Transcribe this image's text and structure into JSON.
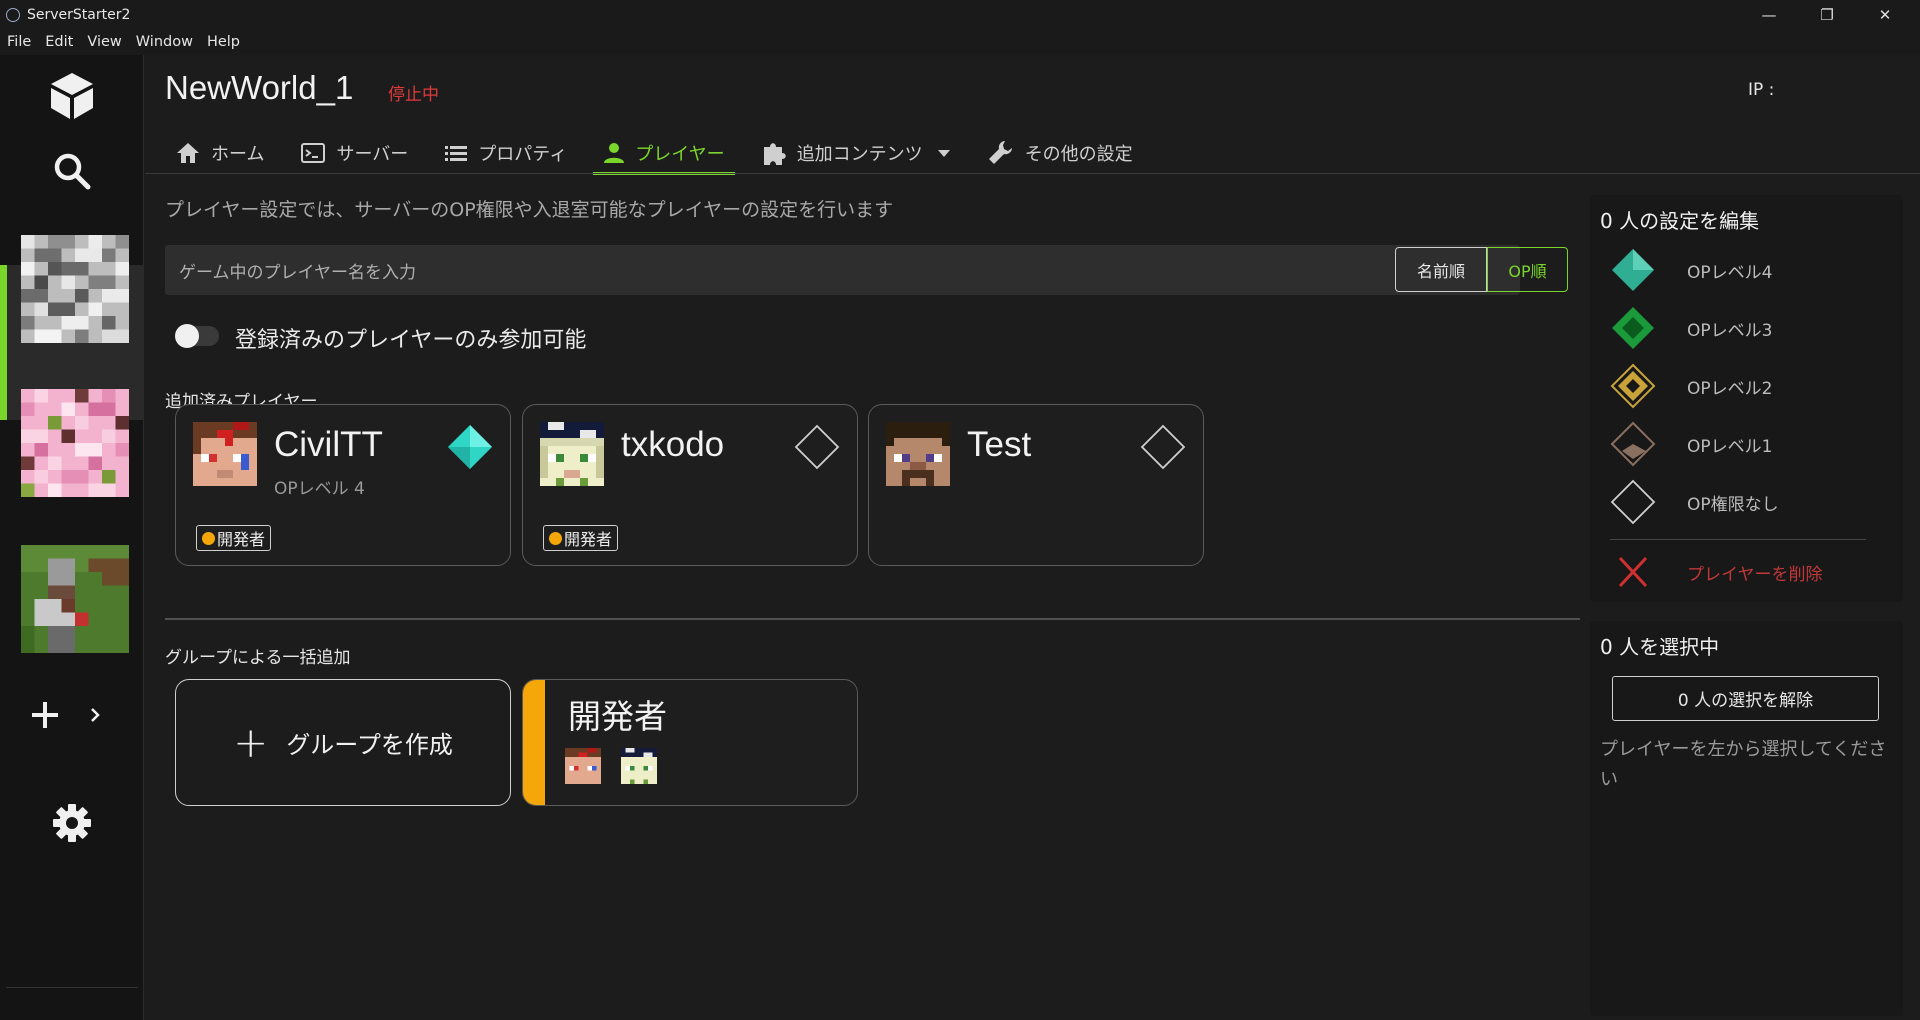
{
  "window": {
    "title": "ServerStarter2"
  },
  "menu": [
    "File",
    "Edit",
    "View",
    "Window",
    "Help"
  ],
  "server": {
    "name": "NewWorld_1",
    "status": "停止中",
    "ip_label": "IP :"
  },
  "tabs": [
    {
      "label": "ホーム",
      "icon": "home-icon"
    },
    {
      "label": "サーバー",
      "icon": "terminal-icon"
    },
    {
      "label": "プロパティ",
      "icon": "list-icon"
    },
    {
      "label": "プレイヤー",
      "icon": "person-icon",
      "active": true
    },
    {
      "label": "追加コンテンツ",
      "icon": "puzzle-icon"
    },
    {
      "label": "その他の設定",
      "icon": "wrench-icon"
    }
  ],
  "players_page": {
    "description": "プレイヤー設定では、サーバーのOP権限や入退室可能なプレイヤーの設定を行います",
    "search_placeholder": "ゲーム中のプレイヤー名を入力",
    "sort_name": "名前順",
    "sort_op": "OP順",
    "whitelist_label": "登録済みのプレイヤーのみ参加可能",
    "added_title": "追加済みプレイヤー",
    "group_title": "グループによる一括追加",
    "create_group": "グループを作成"
  },
  "players": [
    {
      "name": "CivilTT",
      "level": "OPレベル 4",
      "group": "開発者",
      "op_color": "#3fe0d0"
    },
    {
      "name": "txkodo",
      "level": "",
      "group": "開発者",
      "op_color": ""
    },
    {
      "name": "Test",
      "level": "",
      "group": "",
      "op_color": ""
    }
  ],
  "groups": [
    {
      "name": "開発者",
      "color": "#f5a70a"
    }
  ],
  "edit_panel": {
    "title": "0 人の設定を編集",
    "levels": [
      {
        "label": "OPレベル4",
        "color": "#2fae94"
      },
      {
        "label": "OPレベル3",
        "color": "#1a9a3a"
      },
      {
        "label": "OPレベル2",
        "color": "#c9a23a"
      },
      {
        "label": "OPレベル1",
        "color": "#8a7060"
      },
      {
        "label": "OP権限なし",
        "color": ""
      }
    ],
    "delete_label": "プレイヤーを削除",
    "delete_color": "#d03030"
  },
  "select_panel": {
    "title": "0 人を選択中",
    "deselect_label": "0 人の選択を解除",
    "hint": "プレイヤーを左から選択してください"
  }
}
